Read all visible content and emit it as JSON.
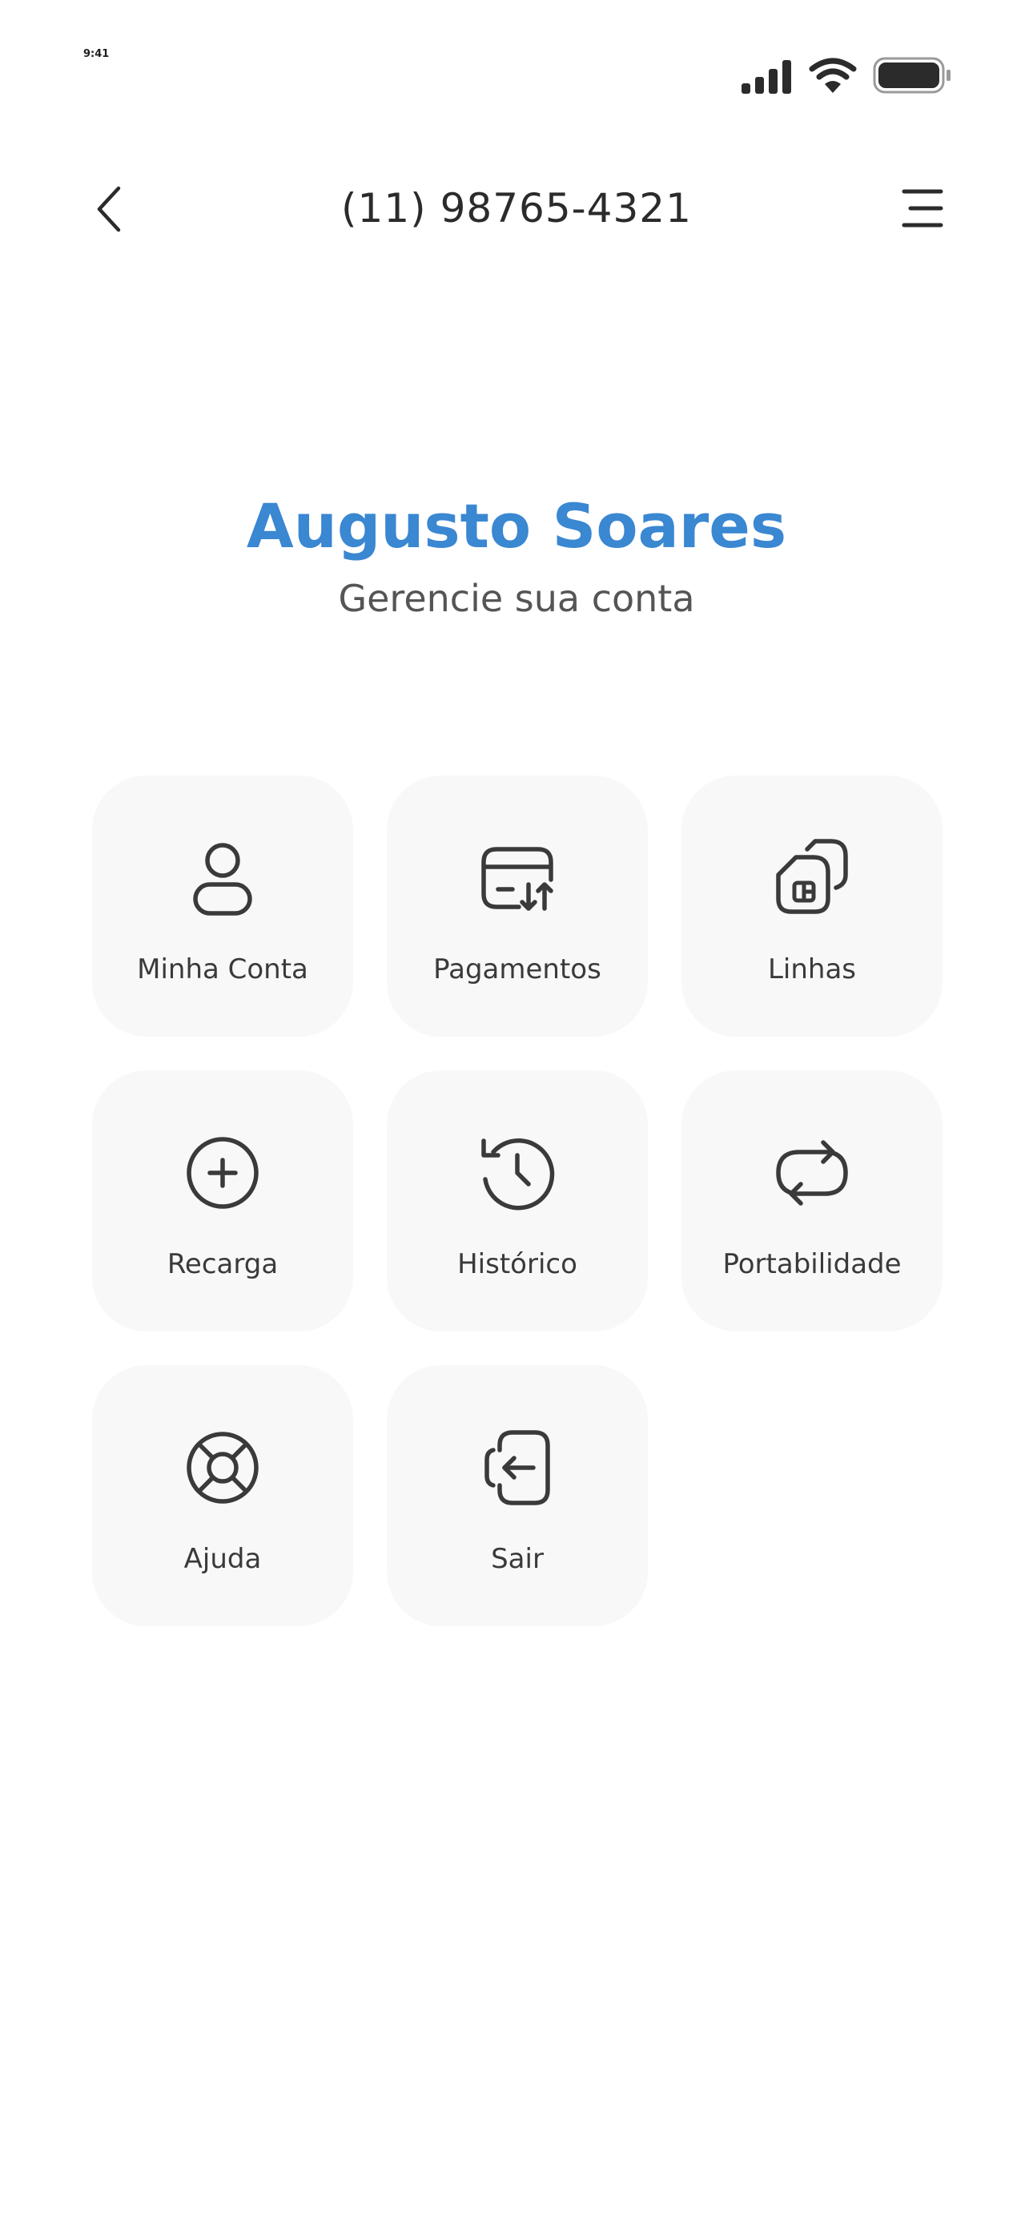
{
  "status_bar": {
    "time": "9:41"
  },
  "header": {
    "title": "(11) 98765-4321"
  },
  "profile": {
    "name": "Augusto Soares",
    "subtitle": "Gerencie sua conta"
  },
  "menu": [
    {
      "label": "Minha Conta",
      "icon": "user-icon"
    },
    {
      "label": "Pagamentos",
      "icon": "card-transfer-icon"
    },
    {
      "label": "Linhas",
      "icon": "sim-cards-icon"
    },
    {
      "label": "Recarga",
      "icon": "plus-circle-icon"
    },
    {
      "label": "Histórico",
      "icon": "history-clock-icon"
    },
    {
      "label": "Portabilidade",
      "icon": "repeat-arrows-icon"
    },
    {
      "label": "Ajuda",
      "icon": "lifebuoy-icon"
    },
    {
      "label": "Sair",
      "icon": "logout-icon"
    }
  ],
  "colors": {
    "accent": "#3a87d2",
    "tile_background": "#f8f8f8",
    "icon": "#3a3a3a"
  }
}
